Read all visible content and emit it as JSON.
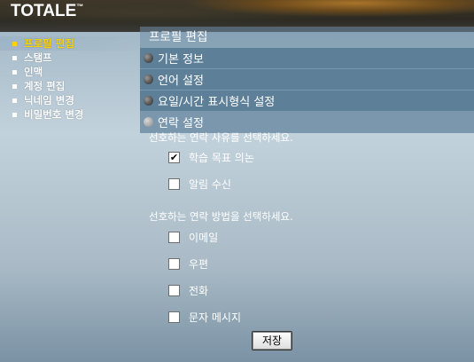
{
  "brand": {
    "logo": "TOTALE",
    "tm": "™"
  },
  "nav": [
    {
      "label": "프로필 편집",
      "active": true
    },
    {
      "label": "스탬프"
    },
    {
      "label": "인맥"
    },
    {
      "label": "계정 편집"
    },
    {
      "label": "닉네임 변경"
    },
    {
      "label": "비밀번호 변경"
    }
  ],
  "panel": {
    "title": "프로필 편집",
    "sections": [
      {
        "label": "기본 정보",
        "state": "collapsed"
      },
      {
        "label": "언어 설정",
        "state": "collapsed"
      },
      {
        "label": "요일/시간 표시형식 설정",
        "state": "collapsed"
      },
      {
        "label": "연락 설정",
        "state": "expanded"
      }
    ],
    "reasons_prompt": "선호하는 연락 사유를 선택하세요.",
    "reasons": [
      {
        "label": "학습 목표 의논",
        "checked": true
      },
      {
        "label": "알림 수신",
        "checked": false
      }
    ],
    "methods_prompt": "선호하는 연락 방법을 선택하세요.",
    "methods": [
      {
        "label": "이메일",
        "checked": false
      },
      {
        "label": "우편",
        "checked": false
      },
      {
        "label": "전화",
        "checked": false
      },
      {
        "label": "문자 메시지",
        "checked": false
      }
    ],
    "save_label": "저장",
    "check_glyph": "✔"
  }
}
